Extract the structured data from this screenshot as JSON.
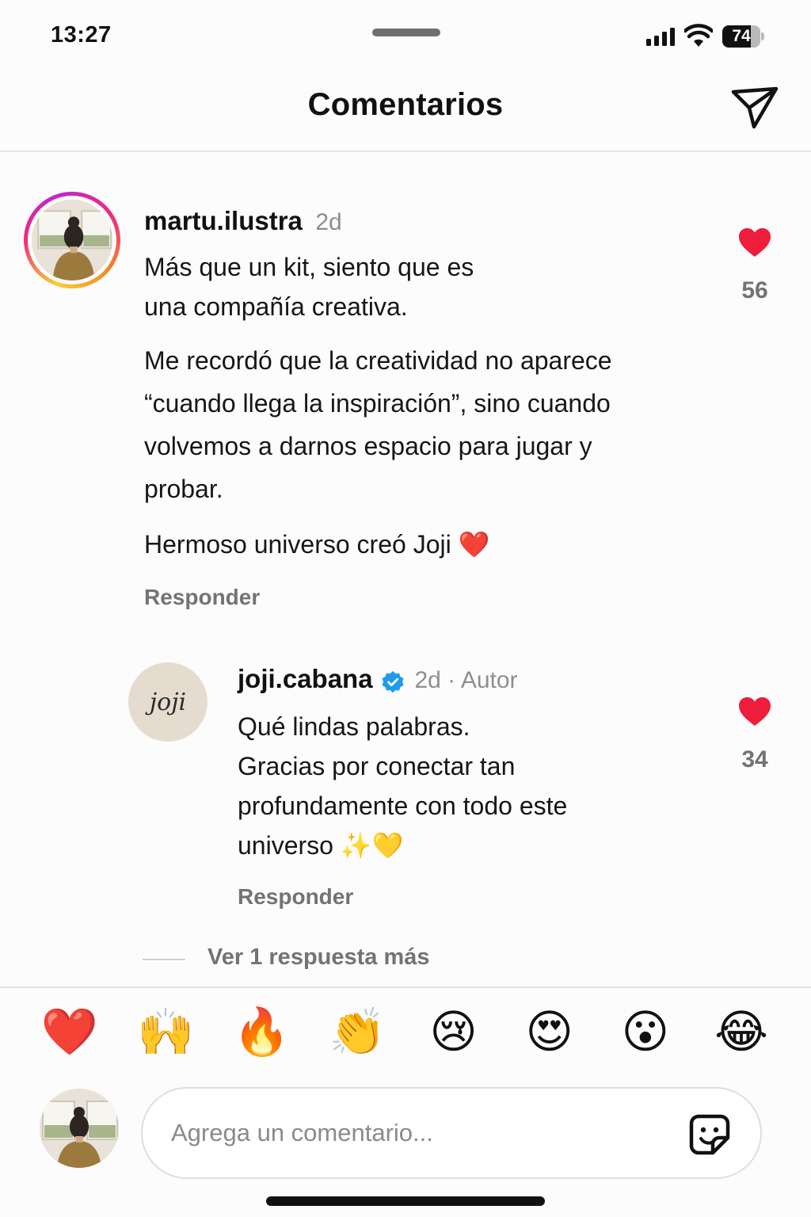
{
  "status_bar": {
    "time": "13:27",
    "battery": "74",
    "battery_level": 0.74
  },
  "header": {
    "title": "Comentarios",
    "send_icon": "paper-plane-icon"
  },
  "comments": [
    {
      "username": "martu.ilustra",
      "time": "2d",
      "lines": [
        "Más que un kit,  siento que es",
        "una compañía creativa."
      ],
      "paragraphs": [
        "Me recordó que la creatividad no aparece",
        "“cuando llega la inspiración”, sino cuando",
        "volvemos a darnos espacio para jugar y",
        "probar."
      ],
      "closing": "Hermoso universo creó Joji ❤️",
      "reply_label": "Responder",
      "likes": "56",
      "liked": true
    },
    {
      "username": "joji.cabana",
      "verified": true,
      "meta": "2d · Autor",
      "avatar_text": "joji",
      "lines": [
        "Qué lindas palabras.",
        "Gracias por conectar tan",
        "profundamente con todo este",
        "universo ✨💛"
      ],
      "reply_label": "Responder",
      "likes": "34",
      "liked": true
    }
  ],
  "view_more": "Ver 1 respuesta más",
  "reactions": [
    "❤️",
    "🙌",
    "🔥",
    "👏",
    "😢",
    "😍",
    "😮",
    "😂"
  ],
  "composer": {
    "placeholder": "Agrega un comentario...",
    "value": "",
    "sticker_icon": "sticker-icon"
  },
  "colors": {
    "heart": "#ef1d3c",
    "verified": "#1d9bf0",
    "muted": "#737373"
  }
}
